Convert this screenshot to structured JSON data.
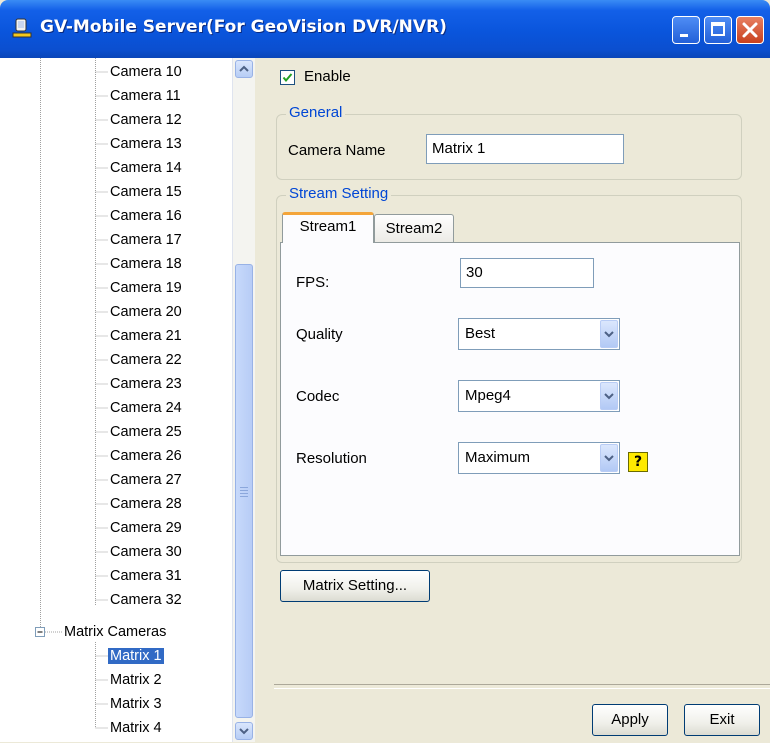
{
  "window": {
    "title": "GV-Mobile Server(For GeoVision DVR/NVR)",
    "buttons": [
      "minimize",
      "maximize",
      "close"
    ]
  },
  "tree": {
    "cameras": [
      "Camera 10",
      "Camera 11",
      "Camera 12",
      "Camera 13",
      "Camera 14",
      "Camera 15",
      "Camera 16",
      "Camera 17",
      "Camera 18",
      "Camera 19",
      "Camera 20",
      "Camera 21",
      "Camera 22",
      "Camera 23",
      "Camera 24",
      "Camera 25",
      "Camera 26",
      "Camera 27",
      "Camera 28",
      "Camera 29",
      "Camera 30",
      "Camera 31",
      "Camera 32"
    ],
    "group_label": "Matrix Cameras",
    "matrix": [
      "Matrix 1",
      "Matrix 2",
      "Matrix 3",
      "Matrix 4"
    ],
    "selected": "Matrix 1"
  },
  "enable": {
    "label": "Enable",
    "checked": true
  },
  "general": {
    "legend": "General",
    "camera_name_label": "Camera Name",
    "camera_name_value": "Matrix 1"
  },
  "stream": {
    "legend": "Stream Setting",
    "tabs": [
      "Stream1",
      "Stream2"
    ],
    "active_tab": "Stream1",
    "fps_label": "FPS:",
    "fps_value": "30",
    "quality_label": "Quality",
    "quality_value": "Best",
    "codec_label": "Codec",
    "codec_value": "Mpeg4",
    "resolution_label": "Resolution",
    "resolution_value": "Maximum",
    "help_glyph": "?"
  },
  "buttons": {
    "matrix_setting": "Matrix Setting...",
    "apply": "Apply",
    "exit": "Exit"
  },
  "colors": {
    "title_bar": "#0a55dc",
    "selection": "#316ac5",
    "legend_text": "#0046d5",
    "active_tab_accent": "#f4a53a"
  }
}
